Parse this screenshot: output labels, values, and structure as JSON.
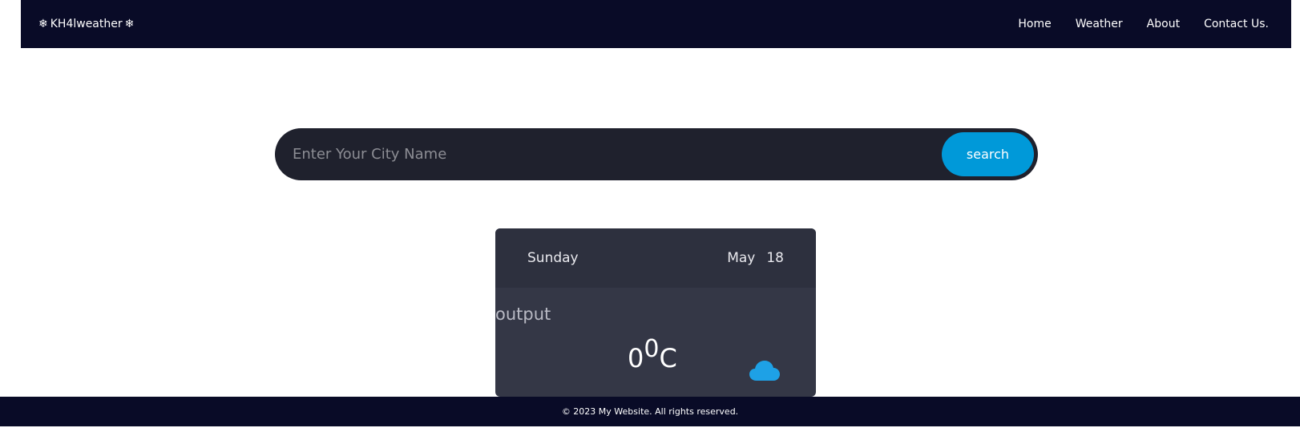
{
  "navbar": {
    "brand": "KH4lweather",
    "brand_icon": "snowflake-icon",
    "links": [
      "Home",
      "Weather",
      "About",
      "Contact Us."
    ]
  },
  "search": {
    "placeholder": "Enter Your City Name",
    "value": "",
    "button_label": "search"
  },
  "card": {
    "day": "Sunday",
    "month": "May",
    "date": "18",
    "city": "output",
    "temp_value": "0",
    "temp_deg": "0",
    "temp_unit": "C",
    "weather_icon": "cloud-icon",
    "icon_color": "#1ea1e6"
  },
  "footer": {
    "text": "© 2023 My Website. All rights reserved."
  },
  "colors": {
    "navbar_bg": "#090b27",
    "search_bg": "#1f212d",
    "button_bg": "#0099d9",
    "card_head_bg": "#2d303e",
    "card_body_bg": "#343746"
  }
}
